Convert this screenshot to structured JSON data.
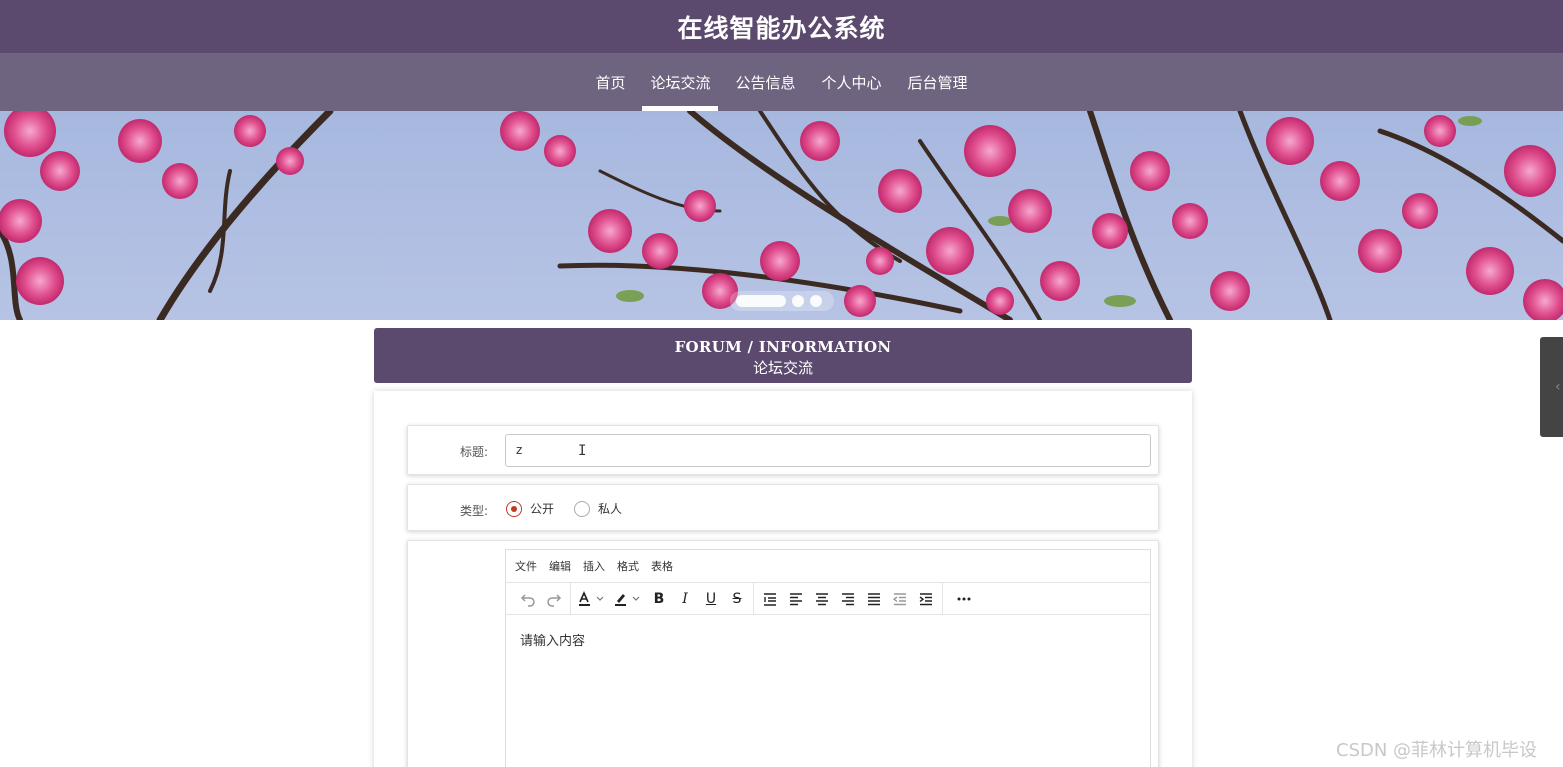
{
  "header": {
    "title": "在线智能办公系统"
  },
  "nav": {
    "items": [
      {
        "label": "首页",
        "active": false
      },
      {
        "label": "论坛交流",
        "active": true
      },
      {
        "label": "公告信息",
        "active": false
      },
      {
        "label": "个人中心",
        "active": false
      },
      {
        "label": "后台管理",
        "active": false
      }
    ]
  },
  "banner": {
    "slide_count": 3,
    "active_slide": 1
  },
  "section": {
    "title_en": "FORUM / INFORMATION",
    "title_cn": "论坛交流"
  },
  "form": {
    "title_label": "标题:",
    "title_value": "z",
    "type_label": "类型:",
    "type_options": [
      {
        "label": "公开",
        "checked": true
      },
      {
        "label": "私人",
        "checked": false
      }
    ],
    "editor": {
      "menu": [
        "文件",
        "编辑",
        "插入",
        "格式",
        "表格"
      ],
      "placeholder": "请输入内容"
    }
  },
  "colors": {
    "header": "#5c4a6e",
    "nav": "#6f6480",
    "accent": "#c0392b"
  },
  "watermark": "CSDN @菲林计算机毕设"
}
